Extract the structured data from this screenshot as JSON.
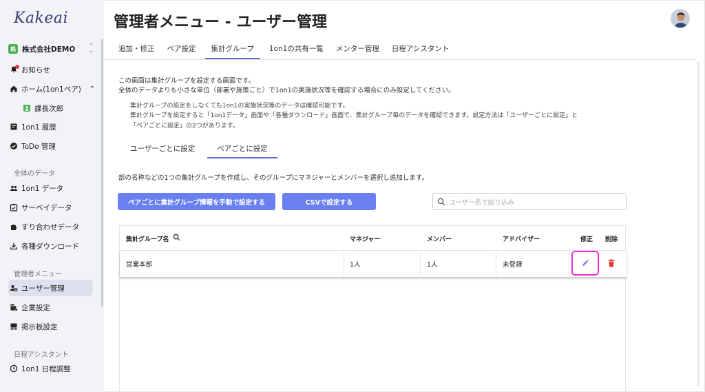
{
  "sidebar": {
    "logo": "Kakeai",
    "company": {
      "badge": "株",
      "name": "株式会社DEMO"
    },
    "items": [
      {
        "label": "お知らせ",
        "icon": "bell-icon"
      },
      {
        "label": "ホーム(1on1ペア)",
        "icon": "home-icon"
      },
      {
        "label": "課長次郎",
        "icon": "user-icon"
      },
      {
        "label": "1on1 履歴",
        "icon": "history-icon"
      },
      {
        "label": "ToDo 管理",
        "icon": "check-circle-icon"
      }
    ],
    "section_all": "全体のデータ",
    "items_all": [
      {
        "label": "1on1 データ",
        "icon": "people-icon"
      },
      {
        "label": "サーベイデータ",
        "icon": "survey-icon"
      },
      {
        "label": "すり合わせデータ",
        "icon": "puzzle-icon"
      },
      {
        "label": "各種ダウンロード",
        "icon": "download-icon"
      }
    ],
    "section_admin": "管理者メニュー",
    "items_admin": [
      {
        "label": "ユーザー管理",
        "icon": "user-settings-icon"
      },
      {
        "label": "企業設定",
        "icon": "building-settings-icon"
      },
      {
        "label": "掲示板設定",
        "icon": "board-icon"
      }
    ],
    "section_assistant": "日程アシスタント",
    "items_assistant": [
      {
        "label": "1on1 日程調整",
        "icon": "clock-icon"
      }
    ]
  },
  "header": {
    "title": "管理者メニュー - ユーザー管理"
  },
  "tabs": [
    {
      "label": "追加・修正"
    },
    {
      "label": "ペア設定"
    },
    {
      "label": "集計グループ"
    },
    {
      "label": "1on1の共有一覧"
    },
    {
      "label": "メンター管理"
    },
    {
      "label": "日程アシスタント"
    }
  ],
  "description": {
    "line1": "この画面は集計グループを設定する画面です。",
    "line2": "全体のデータよりも小さな単位（部署や施策ごと）で1on1の実施状況等を確認する場合にのみ設定してください。"
  },
  "note": {
    "line1": "集計グループの設定をしなくても1on1の実施状況等のデータは確認可能です。",
    "line2": "集計グループを設定すると「1on1データ」画面や「各種ダウンロード」画面で、集計グループ毎のデータを確認できます。設定方法は「ユーザーごとに設定」と",
    "line3": "「ペアごとに設定」の2つがあります。"
  },
  "subtabs": [
    {
      "label": "ユーザーごとに設定"
    },
    {
      "label": "ペアごとに設定"
    }
  ],
  "instruction": "部の名称などの1つの集計グループを作成し、そのグループにマネジャーとメンバーを選択し追加します。",
  "buttons": {
    "manual": "ペアごとに集計グループ情報を手動で設定する",
    "csv": "CSVで設定する"
  },
  "search": {
    "placeholder": "ユーザー名で絞り込み"
  },
  "table": {
    "headers": {
      "group": "集計グループ名",
      "manager": "マネジャー",
      "member": "メンバー",
      "advisor": "アドバイザー",
      "edit": "修正",
      "delete": "削除"
    },
    "rows": [
      {
        "group": "営業本部",
        "manager": "1人",
        "member": "1人",
        "advisor": "未登録"
      }
    ]
  },
  "colors": {
    "accent": "#6a7ff0",
    "highlight": "#ec2fd1",
    "delete": "#e53935"
  }
}
